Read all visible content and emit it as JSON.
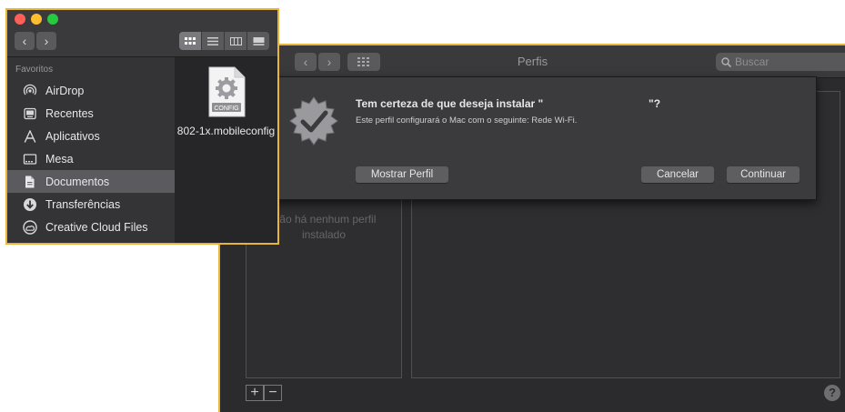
{
  "profiles_window": {
    "title": "Perfis",
    "search_placeholder": "Buscar",
    "empty_text": "Não há nenhum perfil instalado",
    "add_label": "+",
    "remove_label": "−",
    "help_label": "?"
  },
  "sheet": {
    "title": "Tem certeza de que deseja instalar \"",
    "title_end": "\"?",
    "message": "Este perfil configurará o Mac com o seguinte: Rede Wi-Fi.",
    "show_profile_label": "Mostrar Perfil",
    "cancel_label": "Cancelar",
    "continue_label": "Continuar"
  },
  "finder": {
    "nav_back": "<",
    "nav_forward": ">",
    "sidebar_header": "Favoritos",
    "sidebar_items": [
      {
        "label": "AirDrop",
        "icon": "airdrop-icon"
      },
      {
        "label": "Recentes",
        "icon": "clock-icon"
      },
      {
        "label": "Aplicativos",
        "icon": "applications-icon"
      },
      {
        "label": "Mesa",
        "icon": "desktop-icon"
      },
      {
        "label": "Documentos",
        "icon": "documents-icon",
        "selected": true
      },
      {
        "label": "Transferências",
        "icon": "downloads-icon"
      },
      {
        "label": "Creative Cloud Files",
        "icon": "creative-cloud-icon"
      }
    ],
    "file": {
      "name": "802-1x.mobileconfig",
      "badge": "CONFIG"
    }
  },
  "colors": {
    "highlight_border": "#e9b43a",
    "traffic_close": "#fe5f57",
    "traffic_min": "#febc2e",
    "traffic_max": "#28c840"
  }
}
